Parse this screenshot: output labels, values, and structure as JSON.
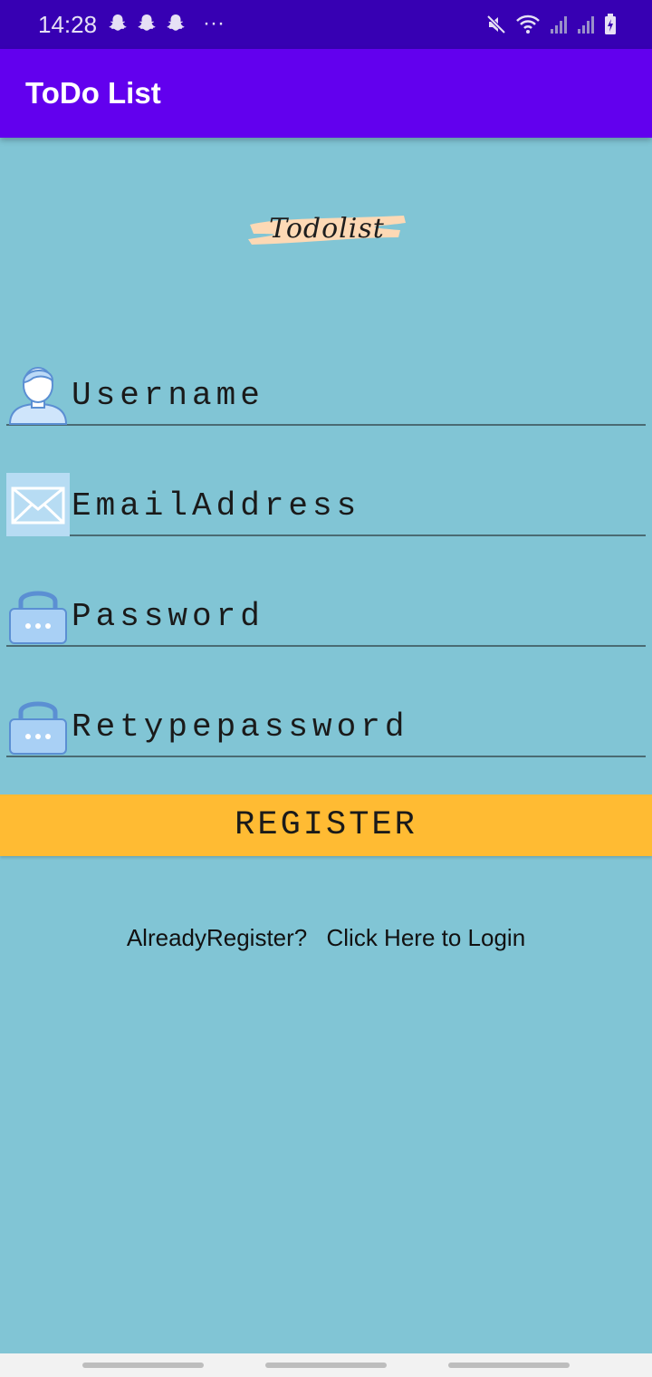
{
  "status_bar": {
    "time": "14:28",
    "more_indicator": "···"
  },
  "app_bar": {
    "title": "ToDo List"
  },
  "logo": {
    "text": "Todolist"
  },
  "form": {
    "fields": [
      {
        "placeholder": "Username",
        "value": "",
        "icon": "user-icon"
      },
      {
        "placeholder": "EmailAddress",
        "value": "",
        "icon": "envelope-icon"
      },
      {
        "placeholder": "Password",
        "value": "",
        "icon": "lock-icon"
      },
      {
        "placeholder": "Retypepassword",
        "value": "",
        "icon": "lock-icon"
      }
    ],
    "register_label": "REGISTER"
  },
  "login": {
    "prompt": "AlreadyRegister?",
    "link": "Click Here to Login"
  },
  "colors": {
    "background": "#81c5d5",
    "status_bar": "#3700b3",
    "app_bar": "#6200ee",
    "register_button": "#ffbb33",
    "logo_brush": "#fdd9b5"
  }
}
